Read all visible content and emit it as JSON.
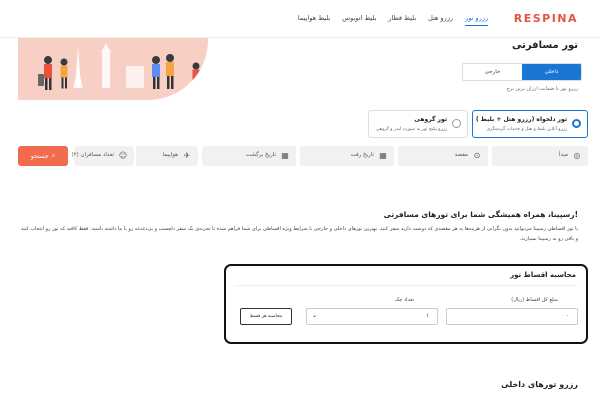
{
  "nav": {
    "logo": "RESPINA",
    "links": [
      "رزرو تور",
      "رزرو هتل",
      "بلیط قطار",
      "بلیط اتوبوس",
      "بلیط هواپیما"
    ]
  },
  "hero": {
    "title": "تور مسافرتی",
    "tabs": [
      "داخلی",
      "خارجی"
    ],
    "subtitle": "رزرو تور با ضمانت ارزان ترین نرخ"
  },
  "cards": [
    {
      "title": "تور دلخواه (رزرو هتل + بلیط )",
      "desc": "رزرو آنلاین بلیط و هتل و خدمات گردشگری"
    },
    {
      "title": "تور گروهی",
      "desc": "رزرو پکیج تور به صورت لیدر و گروهی"
    }
  ],
  "search": {
    "origin": "مبدأ",
    "destination": "مقصد",
    "depart_date": "تاریخ رفت",
    "return_date": "تاریخ برگشت",
    "transport": "هواپیما",
    "passengers": "تعداد مسافران (۲)",
    "button": "جستجو"
  },
  "article": {
    "title": "رسپینا، همراه همیشگی شما برای تورهای مسافرتی!",
    "body": "با تور اقساطی رسپینا می‌توانید بدون نگرانی از هزینه‌ها به هر مقصدی که دوست دارید سفر کنید. بهترین تورهای داخلی و خارجی با شرایط ویژه اقساطی برای شما فراهم شده تا تجربه‌ی یک سفر دلچسب و بی‌دغدغه رو با ما داشته باشید. فقط کافیه که تور رو انتخاب کنید و باقی رو به رسپینا بسپارید."
  },
  "calculator": {
    "title": "محاسبه اقساط تور",
    "amount_label": "مبلغ کل اقساط (ریال)",
    "amount_value": "۰",
    "cheques_label": "تعداد چک",
    "cheques_value": "۱",
    "button": "محاسبه هر قسط"
  },
  "section2": {
    "title": "رزرو تورهای داخلی"
  },
  "colors": {
    "brand": "#e8523f",
    "accent": "#1976d2",
    "button": "#f26b4f",
    "hero_bg": "#f7cfc4"
  }
}
